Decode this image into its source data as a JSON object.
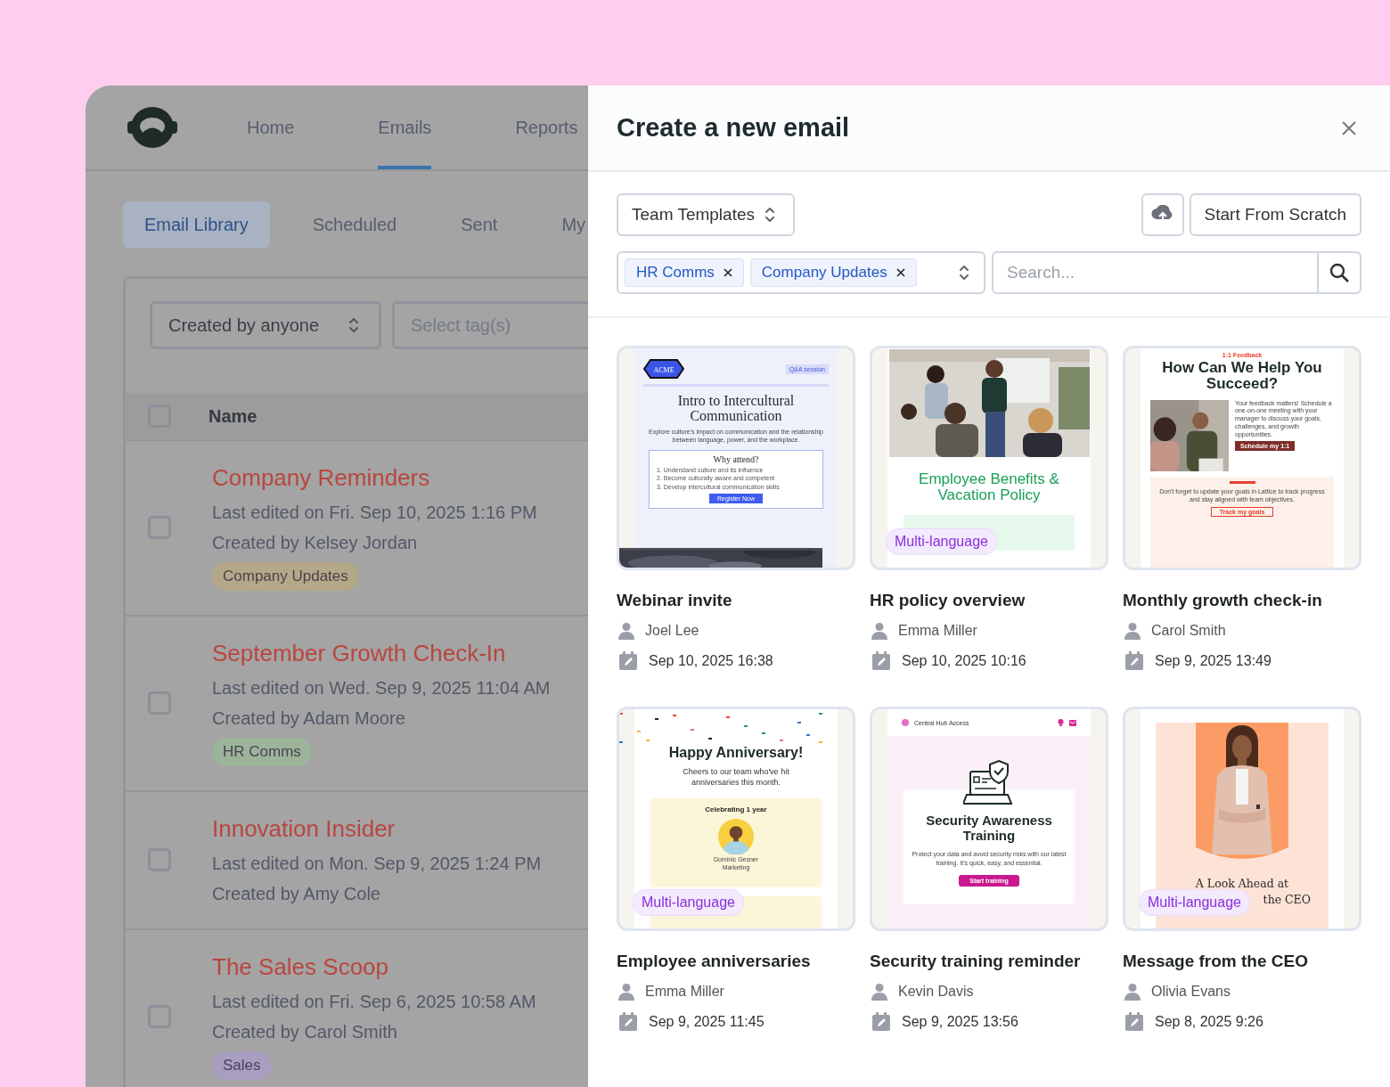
{
  "app": {
    "nav": [
      {
        "label": "Home",
        "selected": false
      },
      {
        "label": "Emails",
        "selected": true
      },
      {
        "label": "Reports",
        "selected": false
      }
    ],
    "subtabs": [
      {
        "label": "Email Library",
        "selected": true
      },
      {
        "label": "Scheduled",
        "selected": false
      },
      {
        "label": "Sent",
        "selected": false
      },
      {
        "label": "My",
        "selected": false
      }
    ],
    "creator_filter": {
      "value": "Created by anyone"
    },
    "tag_filter": {
      "placeholder": "Select tag(s)"
    },
    "table": {
      "select_all": {
        "checked": false
      },
      "columns": [
        "Name"
      ],
      "rows": [
        {
          "title": "Company Reminders",
          "edited": "Last edited on Fri. Sep 10, 2025 1:16 PM",
          "creator": "Created by Kelsey Jordan",
          "checked": false,
          "tag": {
            "label": "Company Updates",
            "color": "#b4a888"
          }
        },
        {
          "title": "September Growth Check-In",
          "edited": "Last edited on Wed. Sep 9, 2025 11:04 AM",
          "creator": "Created by Adam Moore",
          "checked": false,
          "tag": {
            "label": "HR Comms",
            "color": "#9cb49a"
          }
        },
        {
          "title": "Innovation Insider",
          "edited": "Last edited on Mon. Sep 9, 2025 1:24 PM",
          "creator": "Created by Amy Cole",
          "checked": false
        },
        {
          "title": "The Sales Scoop",
          "edited": "Last edited on Fri. Sep 6, 2025 10:58 AM",
          "creator": "Created by Carol Smith",
          "checked": false,
          "tag": {
            "label": "Sales",
            "color": "#a89ec0"
          }
        }
      ]
    }
  },
  "drawer": {
    "title": "Create a new email",
    "source": {
      "value": "Team Templates"
    },
    "start_button": "Start From Scratch",
    "tag_select": {
      "tags": [
        "HR Comms",
        "Company Updates"
      ]
    },
    "search": {
      "placeholder": "Search..."
    },
    "templates": [
      {
        "name": "Webinar invite",
        "author": "Joel Lee",
        "date": "Sep 10, 2025 16:38",
        "preview": {
          "kind": "webinar",
          "logo": "ACME",
          "badge": "Q&A session",
          "title": "Intro to Intercultural Communication",
          "text": "Explore culture's impact on communication and the relationship between language, power, and the workplace.",
          "box_title": "Why attend?",
          "points": [
            "1. Understand culture and its influence",
            "2. Become culturally aware and competent",
            "3. Develop intercultural communication skills"
          ],
          "button": "Register Now"
        }
      },
      {
        "name": "HR policy overview",
        "author": "Emma Miller",
        "date": "Sep 10, 2025 10:16",
        "badge": "Multi-language",
        "preview": {
          "kind": "policy",
          "title": "Employee Benefits & Vacation Policy"
        }
      },
      {
        "name": "Monthly growth check-in",
        "author": "Carol Smith",
        "date": "Sep 9, 2025 13:49",
        "preview": {
          "kind": "feedback",
          "eyebrow": "1:1 Feedback",
          "title": "How Can We Help You Succeed?",
          "text": "Your feedback matters! Schedule a one-on-one meeting with your manager to discuss your goals, challenges, and growth opportunities.",
          "button": "Schedule my 1:1",
          "note": "Don't forget to update your goals in Lattice to track progress and stay aligned with team objectives.",
          "link_button": "Track my goals"
        }
      },
      {
        "name": "Employee anniversaries",
        "author": "Emma Miller",
        "date": "Sep 9, 2025 11:45",
        "badge": "Multi-language",
        "preview": {
          "kind": "anniversary",
          "title": "Happy Anniversary!",
          "text": "Cheers to our team who've hit anniversaries this month.",
          "card_title": "Celebrating 1 year",
          "person": "Dominic Gesner",
          "team": "Marketing"
        }
      },
      {
        "name": "Security training reminder",
        "author": "Kevin Davis",
        "date": "Sep 9, 2025 13:56",
        "preview": {
          "kind": "security",
          "brand": "Central Hub Access",
          "title": "Security Awareness Training",
          "text": "Protect your data and avoid security risks with our latest training. It's quick, easy, and essential.",
          "button": "Start training"
        }
      },
      {
        "name": "Message from the CEO",
        "author": "Olivia Evans",
        "date": "Sep 8, 2025 9:26",
        "badge": "Multi-language",
        "preview": {
          "kind": "ceo",
          "title_lines": [
            "A Look Ahead at",
            "the CEO"
          ]
        }
      }
    ]
  }
}
